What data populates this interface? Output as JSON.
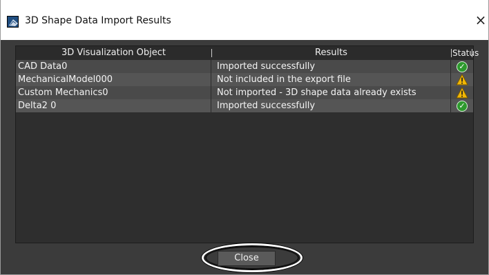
{
  "window": {
    "title": "3D Shape Data Import Results",
    "close_glyph": "×"
  },
  "table": {
    "columns": {
      "object": "3D Visualization Object",
      "results": "Results",
      "status": "Status"
    },
    "rows": [
      {
        "object": "CAD Data0",
        "result": "Imported successfully",
        "status": "success"
      },
      {
        "object": "MechanicalModel000",
        "result": "Not included in the export file",
        "status": "warning"
      },
      {
        "object": "Custom Mechanics0",
        "result": "Not imported - 3D shape data already exists",
        "status": "warning"
      },
      {
        "object": "Delta2 0",
        "result": "Imported successfully",
        "status": "success"
      }
    ]
  },
  "footer": {
    "close_label": "Close"
  },
  "icons": {
    "app": "3d-shape-app-icon",
    "success": "check-circle-icon",
    "warning": "warning-triangle-icon"
  },
  "colors": {
    "success": "#2d9a2d",
    "warning": "#f2b705"
  }
}
